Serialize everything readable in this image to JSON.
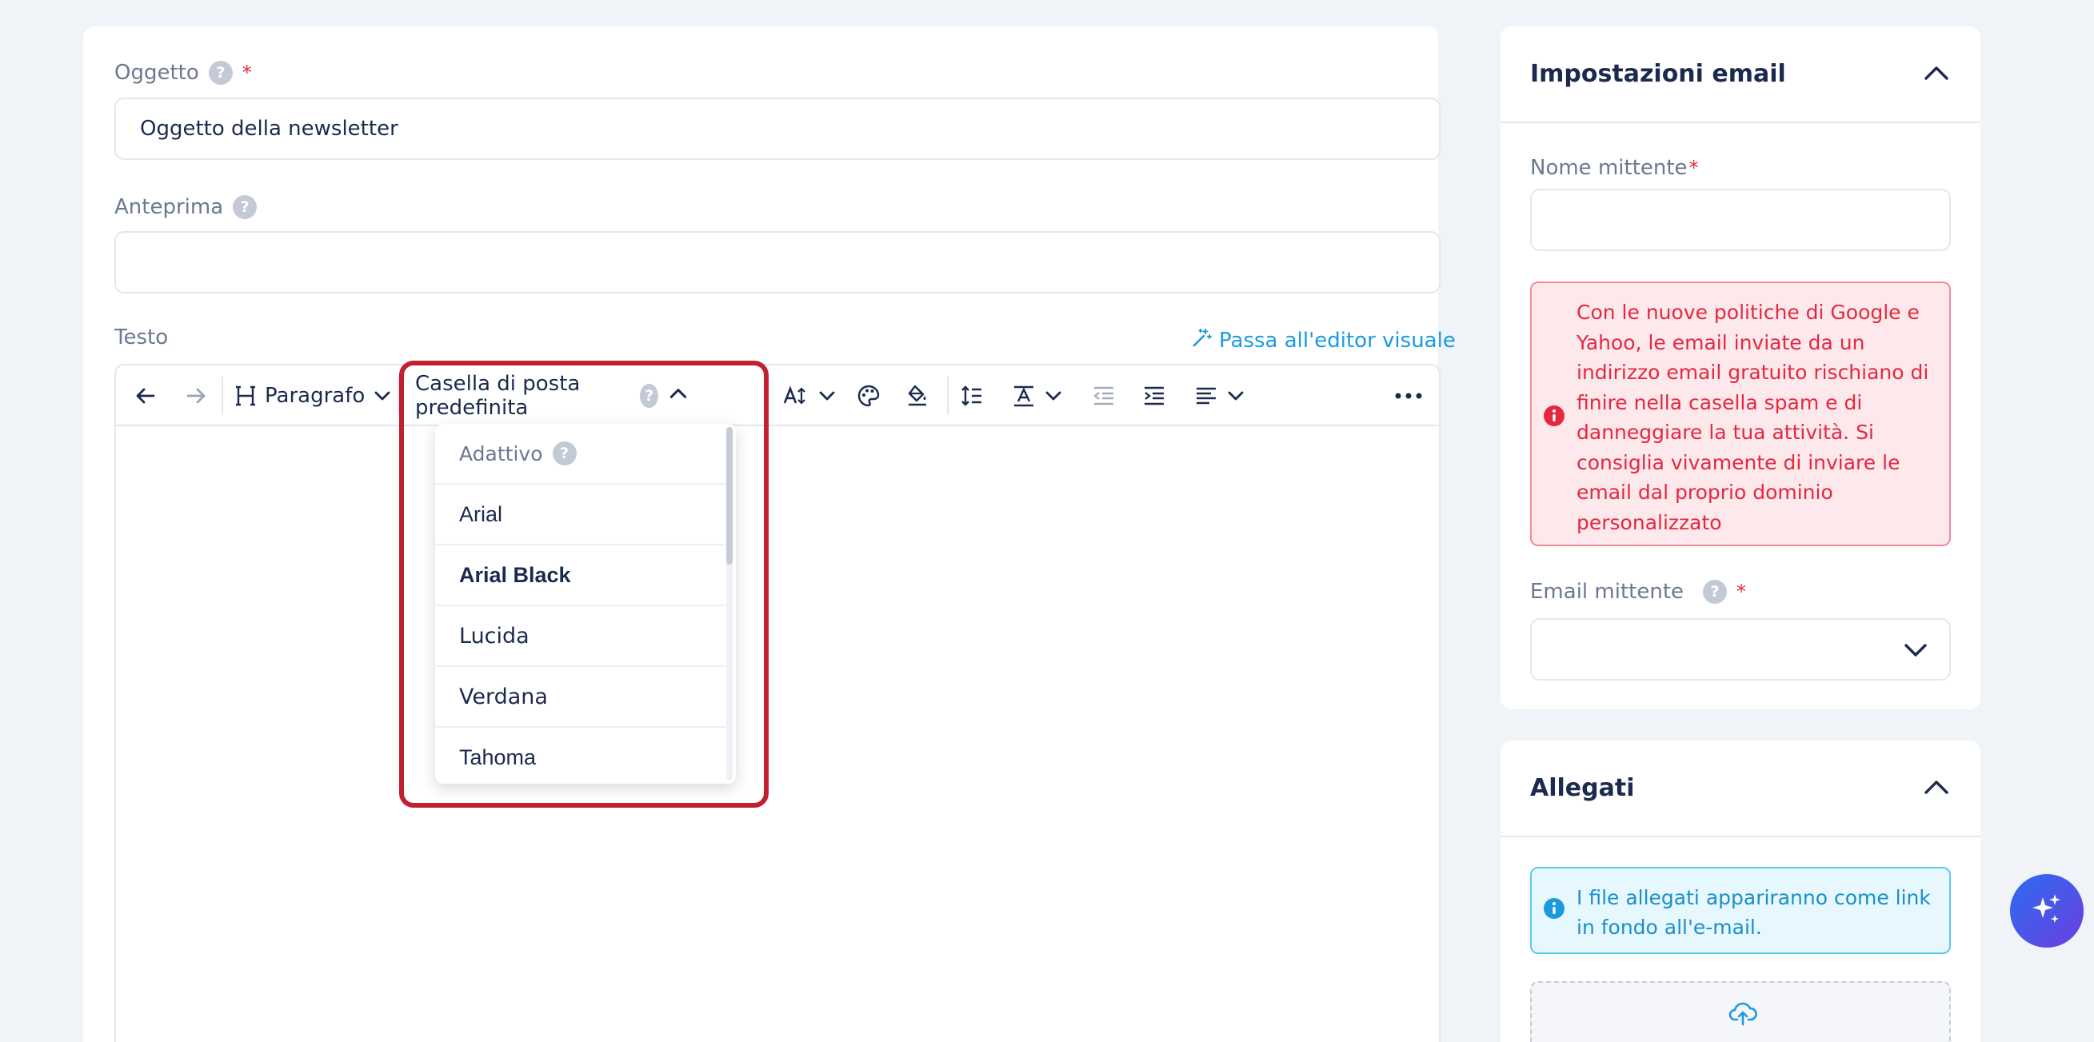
{
  "form": {
    "subject_label": "Oggetto",
    "subject_required": "*",
    "subject_value": "Oggetto della newsletter",
    "preview_label": "Anteprima",
    "preview_value": "",
    "text_label": "Testo",
    "switch_editor_label": "Passa all'editor visuale"
  },
  "toolbar": {
    "paragraph_label": "Paragrafo",
    "font_label": "Casella di posta predefinita",
    "help_glyph": "?"
  },
  "font_dropdown": {
    "header": "Adattivo",
    "items": [
      "Arial",
      "Arial Black",
      "Lucida",
      "Verdana",
      "Tahoma"
    ]
  },
  "email_settings": {
    "title": "Impostazioni email",
    "sender_name_label": "Nome mittente",
    "required_mark": "*",
    "sender_name_value": "",
    "warning": "Con le nuove politiche di Google e Yahoo, le email inviate da un indirizzo email gratuito rischiano di finire nella casella spam e di danneggiare la tua attività. Si consiglia vivamente di inviare le email dal proprio dominio personalizzato",
    "sender_email_label": "Email mittente"
  },
  "attachments": {
    "title": "Allegati",
    "info": "I file allegati appariranno come link in fondo all'e-mail."
  },
  "colors": {
    "accent": "#1a9be0",
    "danger": "#e4283f",
    "highlight": "#c21f2f",
    "text": "#1b2a4e"
  }
}
